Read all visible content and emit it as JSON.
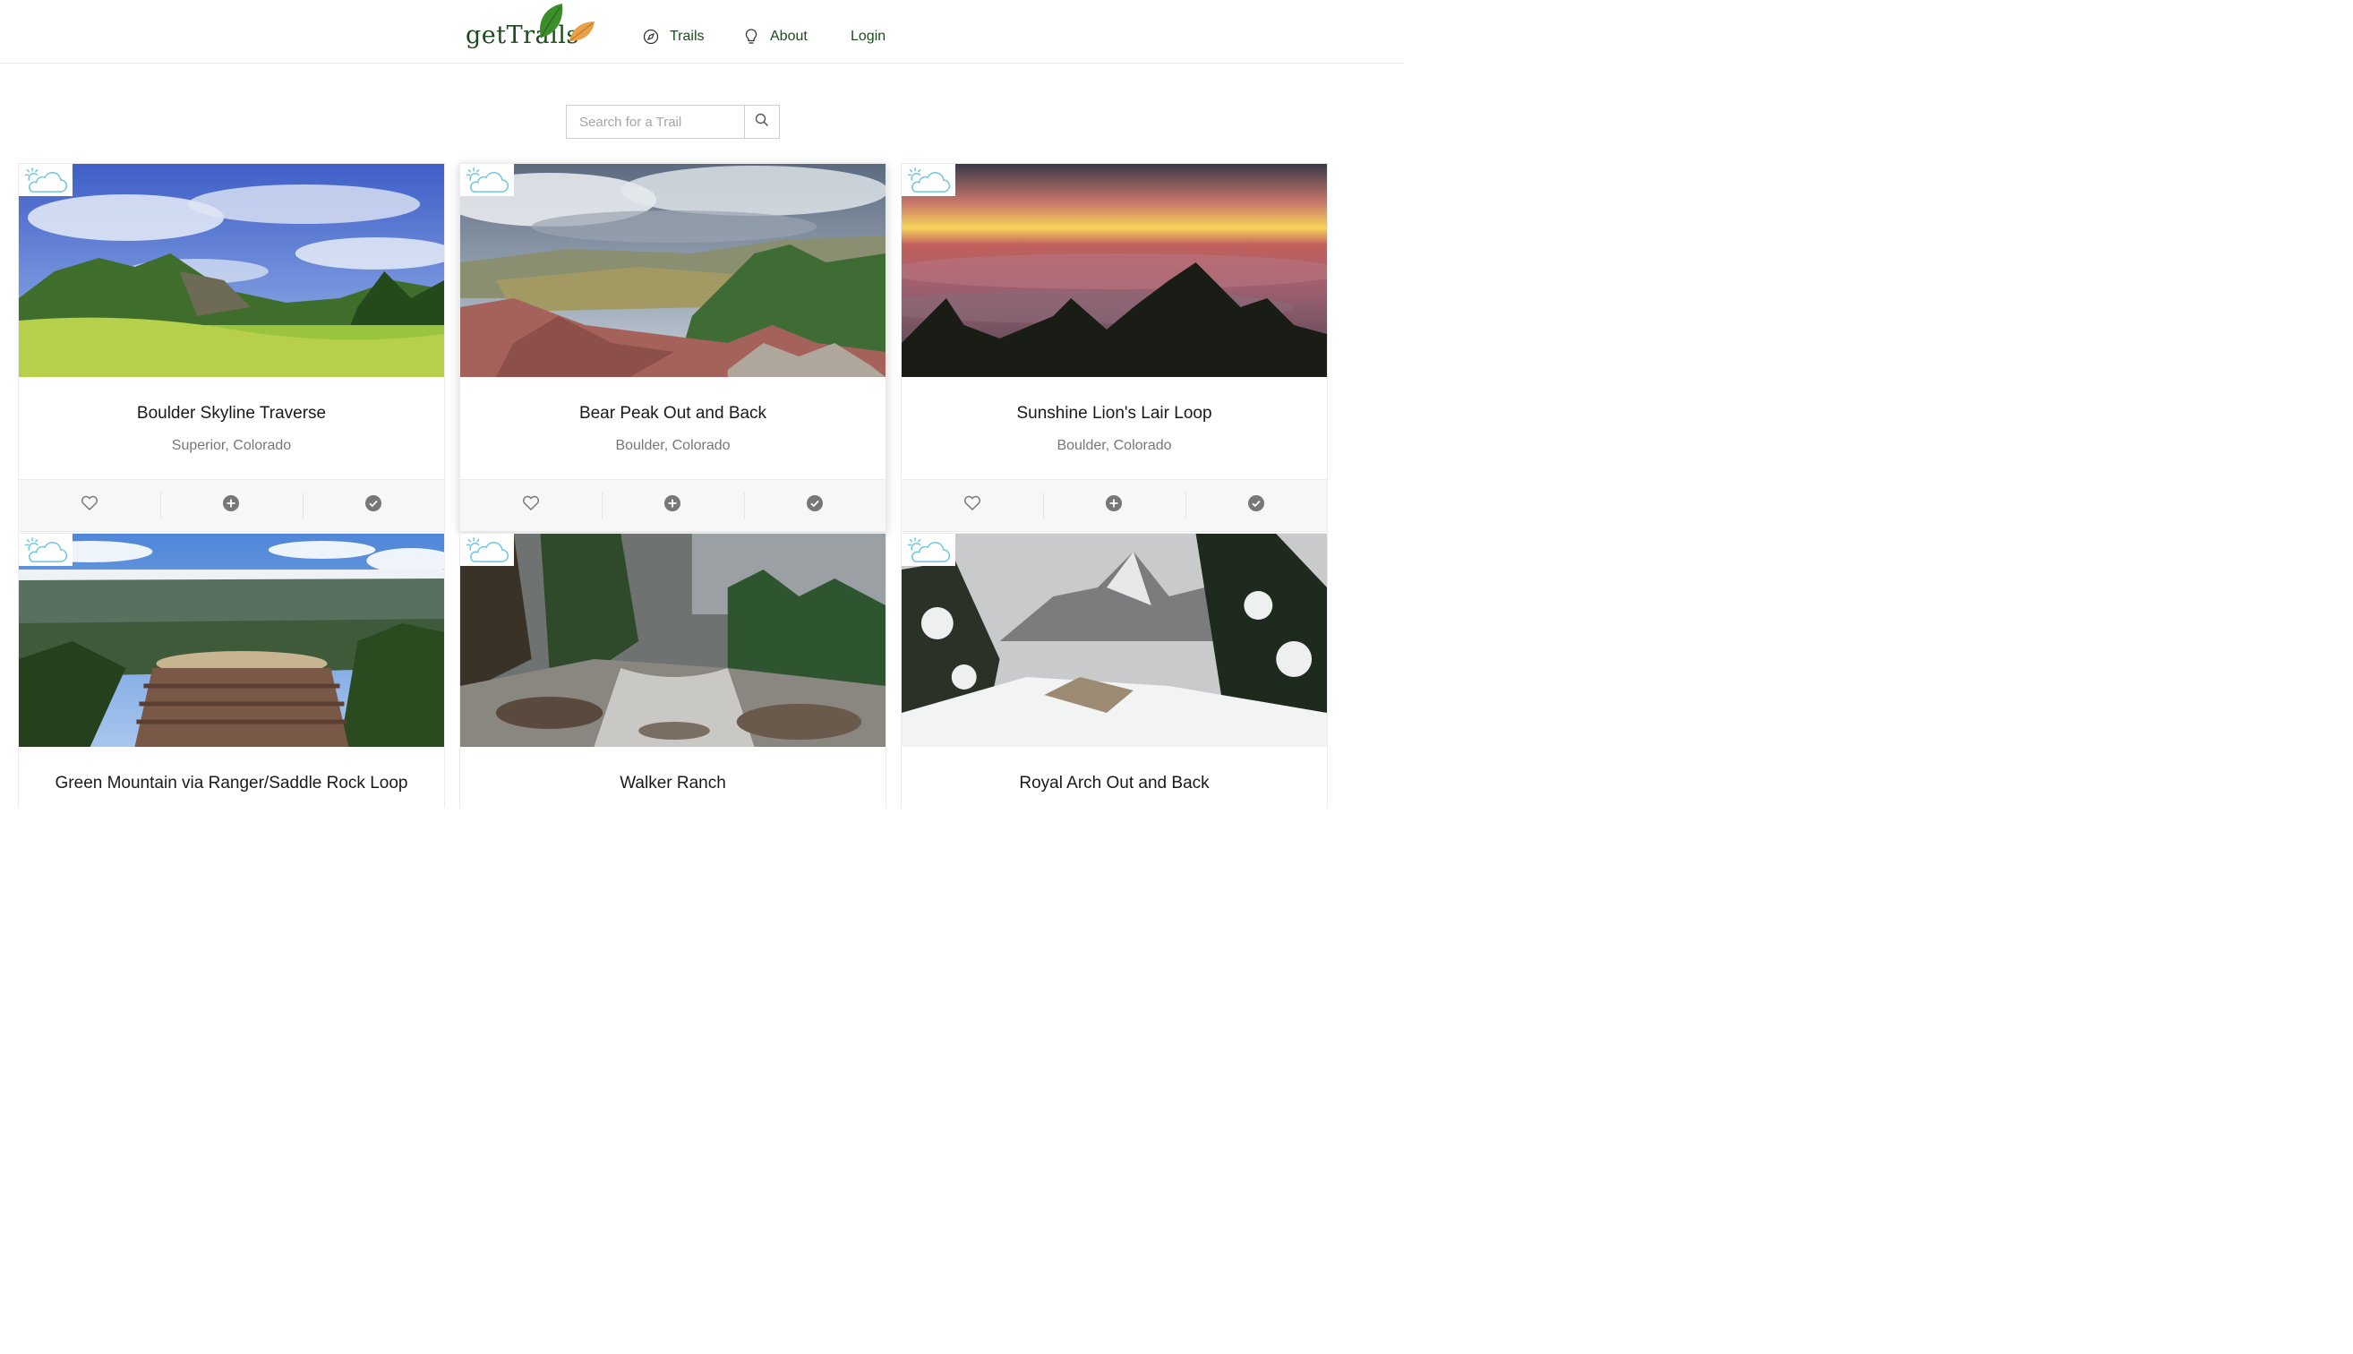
{
  "brand": {
    "name": "getTrails"
  },
  "nav": {
    "trails": {
      "label": "Trails",
      "icon": "compass-icon"
    },
    "about": {
      "label": "About",
      "icon": "lightbulb-icon"
    },
    "login": {
      "label": "Login"
    }
  },
  "search": {
    "placeholder": "Search for a Trail",
    "value": "",
    "button_icon": "search-icon"
  },
  "colors": {
    "brand_green": "#1f4a1f",
    "leaf_green": "#3b8f2a",
    "leaf_orange": "#e8a04a",
    "weather_blue": "#6ec6e0"
  },
  "cards": [
    {
      "title": "Boulder Skyline Traverse",
      "location": "Superior, Colorado",
      "weather": "partly-cloudy-icon",
      "scene": "green-meadow"
    },
    {
      "title": "Bear Peak Out and Back",
      "location": "Boulder, Colorado",
      "weather": "partly-cloudy-icon",
      "scene": "rocky-summit"
    },
    {
      "title": "Sunshine Lion's Lair Loop",
      "location": "Boulder, Colorado",
      "weather": "partly-cloudy-icon",
      "scene": "sunset-clouds"
    },
    {
      "title": "Green Mountain via Ranger/Saddle Rock Loop",
      "location": "",
      "weather": "partly-cloudy-icon",
      "scene": "summit-marker"
    },
    {
      "title": "Walker Ranch",
      "location": "",
      "weather": "partly-cloudy-icon",
      "scene": "creek"
    },
    {
      "title": "Royal Arch Out and Back",
      "location": "",
      "weather": "partly-cloudy-icon",
      "scene": "snowy-flatirons"
    }
  ],
  "card_actions": [
    "heart-icon",
    "plus-circle-icon",
    "check-circle-icon"
  ]
}
